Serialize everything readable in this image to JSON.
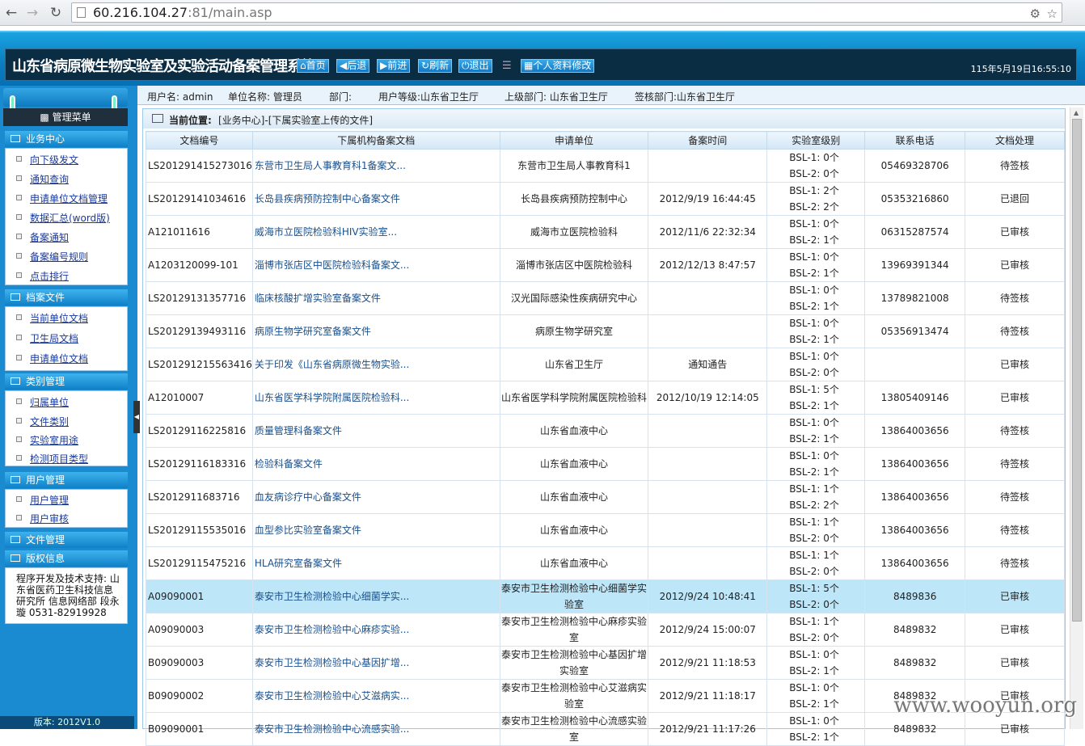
{
  "browser": {
    "url_host": "60.216.104.27",
    "url_rest": ":81/main.asp"
  },
  "header": {
    "title": "山东省病原微生物实验室及实验活动备案管理系统",
    "buttons": [
      "首页",
      "后退",
      "前进",
      "刷新",
      "退出"
    ],
    "profile_button": "个人资料修改",
    "datetime": "115年5月19日16:55:10"
  },
  "userbar": {
    "user": "用户名: admin",
    "unit": "单位名称: 管理员",
    "dept": "部门:",
    "level": "用户等级:山东省卫生厅",
    "superior": "上级部门: 山东省卫生厅",
    "reviewer": "签核部门:山东省卫生厅"
  },
  "sidebar": {
    "menu_title": "管理菜单",
    "sections": [
      {
        "title": "业务中心",
        "items": [
          "向下级发文",
          "通知查询",
          "申请单位文档管理",
          "数据汇总(word版)",
          "备案通知",
          "备案编号规则",
          "点击排行"
        ]
      },
      {
        "title": "档案文件",
        "items": [
          "当前单位文档",
          "卫生局文档",
          "申请单位文档"
        ]
      },
      {
        "title": "类别管理",
        "items": [
          "归属单位",
          "文件类别",
          "实验室用途",
          "检测项目类型"
        ]
      },
      {
        "title": "用户管理",
        "items": [
          "用户管理",
          "用户审核"
        ]
      },
      {
        "title": "文件管理",
        "items": []
      },
      {
        "title": "版权信息",
        "items": []
      }
    ],
    "credit": "程序开发及技术支持: 山东省医药卫生科技信息研究所 信息网络部 段永璇 0531-82919928",
    "version": "版本: 2012V1.0"
  },
  "location": {
    "label": "当前位置:",
    "path": "[业务中心]-[下属实验室上传的文件]"
  },
  "table": {
    "headers": [
      "文档编号",
      "下属机构备案文档",
      "申请单位",
      "备案时间",
      "实验室级别",
      "联系电话",
      "文档处理"
    ],
    "rows": [
      {
        "id": "LS201291415273016",
        "doc": "东营市卫生局人事教育科1备案文...",
        "unit": "东营市卫生局人事教育科1",
        "time": "",
        "bsl1": "BSL-1: 0个",
        "bsl2": "BSL-2: 0个",
        "phone": "05469328706",
        "status": "待签核"
      },
      {
        "id": "LS20129141034616",
        "doc": "长岛县疾病预防控制中心备案文件",
        "unit": "长岛县疾病预防控制中心",
        "time": "2012/9/19 16:44:45",
        "bsl1": "BSL-1: 2个",
        "bsl2": "BSL-2: 2个",
        "phone": "05353216860",
        "status": "已退回"
      },
      {
        "id": "A121011616",
        "doc": "威海市立医院检验科HIV实验室...",
        "unit": "威海市立医院检验科",
        "time": "2012/11/6 22:32:34",
        "bsl1": "BSL-1: 0个",
        "bsl2": "BSL-2: 1个",
        "phone": "06315287574",
        "status": "已审核"
      },
      {
        "id": "A1203120099-101",
        "doc": "淄博市张店区中医院检验科备案文...",
        "unit": "淄博市张店区中医院检验科",
        "time": "2012/12/13 8:47:57",
        "bsl1": "BSL-1: 0个",
        "bsl2": "BSL-2: 1个",
        "phone": "13969391344",
        "status": "已审核"
      },
      {
        "id": "LS20129131357716",
        "doc": "临床核酸扩增实验室备案文件",
        "unit": "汉光国际感染性疾病研究中心",
        "time": "",
        "bsl1": "BSL-1: 0个",
        "bsl2": "BSL-2: 1个",
        "phone": "13789821008",
        "status": "待签核"
      },
      {
        "id": "LS20129139493116",
        "doc": "病原生物学研究室备案文件",
        "unit": "病原生物学研究室",
        "time": "",
        "bsl1": "BSL-1: 0个",
        "bsl2": "BSL-2: 1个",
        "phone": "05356913474",
        "status": "待签核"
      },
      {
        "id": "LS201291215563416",
        "doc": "关于印发《山东省病原微生物实验...",
        "unit": "山东省卫生厅",
        "time": "通知通告",
        "bsl1": "BSL-1: 0个",
        "bsl2": "BSL-2: 0个",
        "phone": "",
        "status": "已审核"
      },
      {
        "id": "A12010007",
        "doc": "山东省医学科学院附属医院检验科...",
        "unit": "山东省医学科学院附属医院检验科",
        "time": "2012/10/19 12:14:05",
        "bsl1": "BSL-1: 5个",
        "bsl2": "BSL-2: 1个",
        "phone": "13805409146",
        "status": "已审核"
      },
      {
        "id": "LS20129116225816",
        "doc": "质量管理科备案文件",
        "unit": "山东省血液中心",
        "time": "",
        "bsl1": "BSL-1: 0个",
        "bsl2": "BSL-2: 1个",
        "phone": "13864003656",
        "status": "待签核"
      },
      {
        "id": "LS20129116183316",
        "doc": "检验科备案文件",
        "unit": "山东省血液中心",
        "time": "",
        "bsl1": "BSL-1: 0个",
        "bsl2": "BSL-2: 1个",
        "phone": "13864003656",
        "status": "待签核"
      },
      {
        "id": "LS2012911683716",
        "doc": "血友病诊疗中心备案文件",
        "unit": "山东省血液中心",
        "time": "",
        "bsl1": "BSL-1: 1个",
        "bsl2": "BSL-2: 2个",
        "phone": "13864003656",
        "status": "待签核"
      },
      {
        "id": "LS20129115535016",
        "doc": "血型参比实验室备案文件",
        "unit": "山东省血液中心",
        "time": "",
        "bsl1": "BSL-1: 1个",
        "bsl2": "BSL-2: 0个",
        "phone": "13864003656",
        "status": "待签核"
      },
      {
        "id": "LS20129115475216",
        "doc": "HLA研究室备案文件",
        "unit": "山东省血液中心",
        "time": "",
        "bsl1": "BSL-1: 1个",
        "bsl2": "BSL-2: 0个",
        "phone": "13864003656",
        "status": "待签核"
      },
      {
        "id": "A09090001",
        "doc": "泰安市卫生检测检验中心细菌学实...",
        "unit": "泰安市卫生检测检验中心细菌学实验室",
        "time": "2012/9/24 10:48:41",
        "bsl1": "BSL-1: 5个",
        "bsl2": "BSL-2: 0个",
        "phone": "8489836",
        "status": "已审核"
      },
      {
        "id": "A09090003",
        "doc": "泰安市卫生检测检验中心麻疹实验...",
        "unit": "泰安市卫生检测检验中心麻疹实验室",
        "time": "2012/9/24 15:00:07",
        "bsl1": "BSL-1: 1个",
        "bsl2": "BSL-2: 0个",
        "phone": "8489832",
        "status": "已审核"
      },
      {
        "id": "B09090003",
        "doc": "泰安市卫生检测检验中心基因扩增...",
        "unit": "泰安市卫生检测检验中心基因扩增实验室",
        "time": "2012/9/21 11:18:53",
        "bsl1": "BSL-1: 0个",
        "bsl2": "BSL-2: 1个",
        "phone": "8489832",
        "status": "已审核"
      },
      {
        "id": "B09090002",
        "doc": "泰安市卫生检测检验中心艾滋病实...",
        "unit": "泰安市卫生检测检验中心艾滋病实验室",
        "time": "2012/9/21 11:18:17",
        "bsl1": "BSL-1: 0个",
        "bsl2": "BSL-2: 1个",
        "phone": "8489832",
        "status": "已审核"
      },
      {
        "id": "B09090001",
        "doc": "泰安市卫生检测检验中心流感实验...",
        "unit": "泰安市卫生检测检验中心流感实验室",
        "time": "2012/9/21 11:17:26",
        "bsl1": "BSL-1: 0个",
        "bsl2": "BSL-2: 1个",
        "phone": "8489832",
        "status": "已审核"
      }
    ]
  },
  "watermark": "www.wooyun.org",
  "highlight_row": 13
}
